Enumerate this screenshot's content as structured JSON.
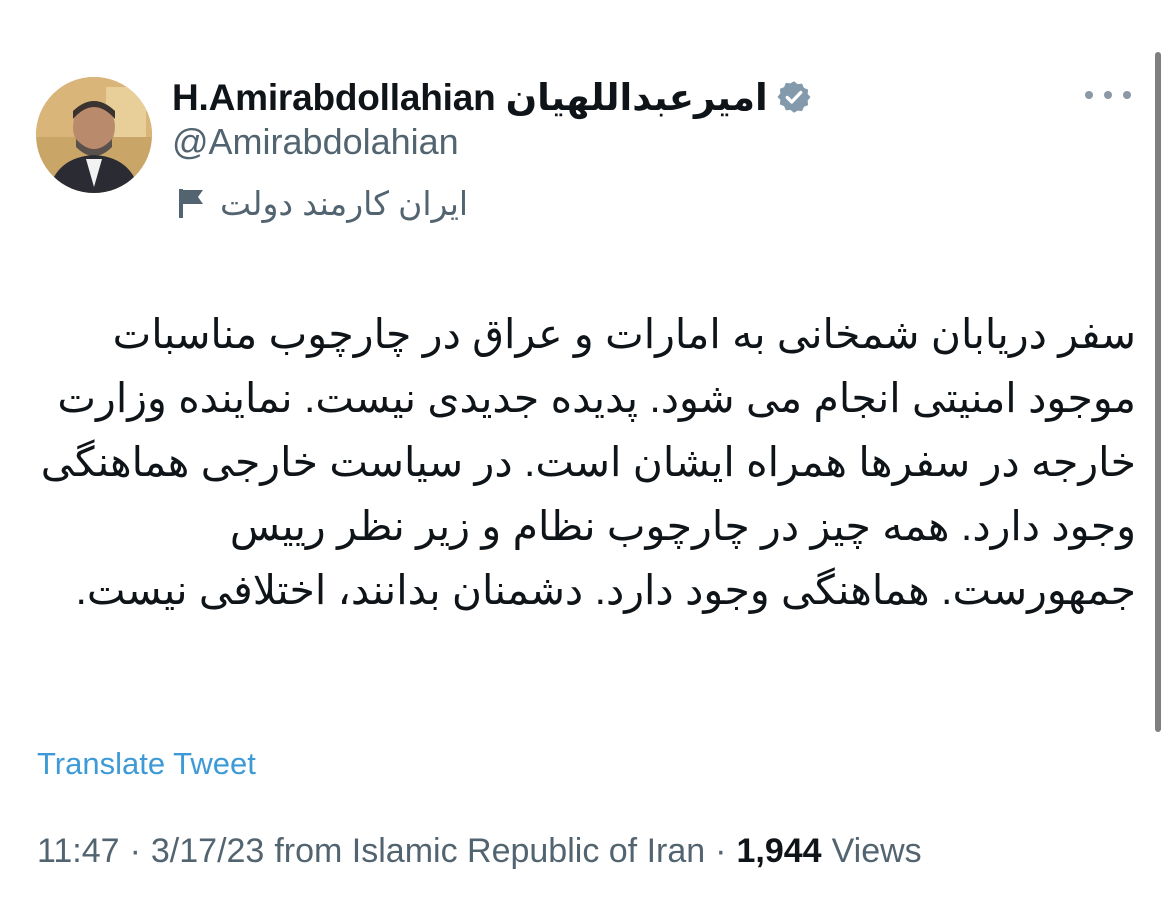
{
  "tweet": {
    "author": {
      "display_name": "H.Amirabdollahian امیرعبداللهیان",
      "handle": "@Amirabdolahian",
      "verified_badge_icon": "verified-badge-icon",
      "affiliation_label": "ایران کارمند دولت",
      "affiliation_icon": "government-flag-icon"
    },
    "more_icon": "more-options-icon",
    "body_text": "سفر دریابان شمخانی به امارات و عراق در چارچوب مناسبات موجود امنیتی انجام می شود. پدیده جدیدی نیست. نماینده وزارت خارجه در سفرها همراه ایشان است. در سیاست خارجی هماهنگی وجود دارد. همه چیز در چارچوب نظام و زیر نظر رییس جمهورست. هماهنگی وجود دارد. دشمنان بدانند، اختلافی نیست.",
    "translate_label": "Translate Tweet",
    "meta": {
      "time": "11:47",
      "separator": "·",
      "date": "3/17/23",
      "source": "from Islamic Republic of Iran",
      "views_count": "1,944",
      "views_label": "Views"
    }
  },
  "colors": {
    "text_primary": "#0f1419",
    "text_secondary": "#536471",
    "link": "#3d9ad6",
    "verified_badge": "#829aab"
  }
}
